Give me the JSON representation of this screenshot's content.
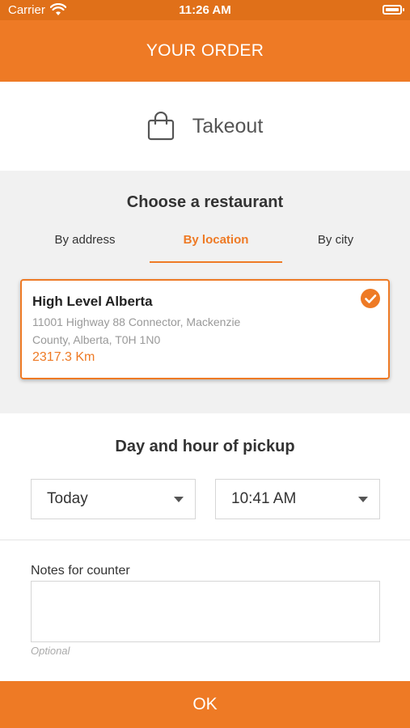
{
  "status_bar": {
    "carrier": "Carrier",
    "time": "11:26 AM"
  },
  "header": {
    "title": "YOUR ORDER"
  },
  "order_mode": {
    "label": "Takeout",
    "icon": "shopping-bag-icon"
  },
  "restaurant": {
    "title": "Choose a restaurant",
    "tabs": [
      {
        "label": "By address",
        "active": false
      },
      {
        "label": "By location",
        "active": true
      },
      {
        "label": "By city",
        "active": false
      }
    ],
    "selected": {
      "name": "High Level Alberta",
      "address_line1": "11001 Highway 88 Connector, Mackenzie",
      "address_line2": "County, Alberta, T0H 1N0",
      "distance": "2317.3 Km",
      "icon": "check-circle-icon"
    }
  },
  "pickup": {
    "title": "Day and hour of pickup",
    "day": "Today",
    "hour": "10:41 AM"
  },
  "notes": {
    "label": "Notes for counter",
    "value": "",
    "hint": "Optional"
  },
  "footer": {
    "ok_label": "OK"
  },
  "colors": {
    "accent": "#ee7a25",
    "status_bar": "#e07019",
    "section_bg": "#f1f1f1"
  }
}
